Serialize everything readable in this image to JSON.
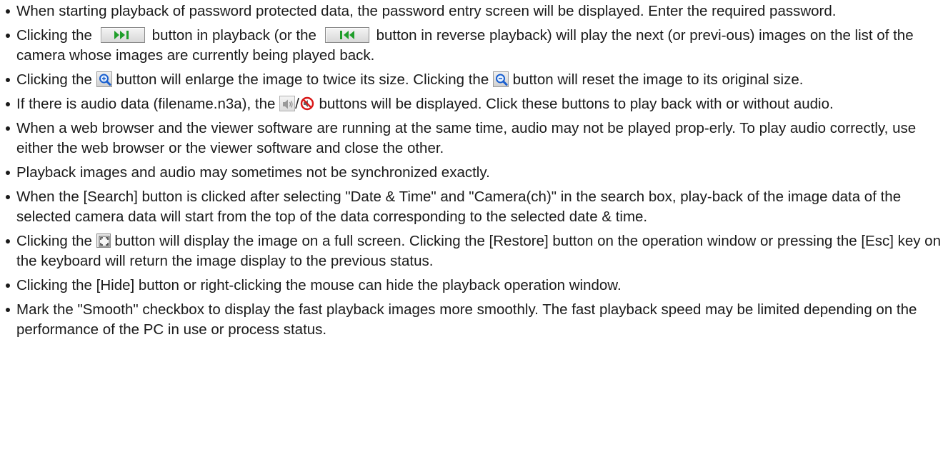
{
  "bullets": [
    {
      "text": "When starting playback of password protected data, the password entry screen will be displayed. Enter the required password."
    },
    {
      "p1": "Clicking the",
      "p2": "button in playback (or the",
      "p3": "button in reverse playback) will play the next (or previ-ous) images on the list of the camera whose images are currently being played back.",
      "icons": [
        "next-track-icon",
        "previous-track-icon"
      ]
    },
    {
      "p1": "Clicking the",
      "p2": "button will enlarge the image to twice its size. Clicking the",
      "p3": "button will reset the image to its original size.",
      "icons": [
        "zoom-in-icon",
        "zoom-reset-icon"
      ]
    },
    {
      "p1": "If there is audio data (filename.n3a), the",
      "sep": "/",
      "p2": "buttons will be displayed. Click these buttons to play back with or without audio.",
      "icons": [
        "speaker-icon",
        "mute-icon"
      ]
    },
    {
      "text": "When a web browser and the viewer software are running at the same time, audio may not be played prop-erly. To play audio correctly, use either the web browser or the viewer software and close the other."
    },
    {
      "text": "Playback images and audio may sometimes not be synchronized exactly."
    },
    {
      "text": "When the [Search] button is clicked after selecting \"Date & Time\" and \"Camera(ch)\" in the search box, play-back of the image data of the selected camera data will start from the top of the data corresponding to the selected date & time."
    },
    {
      "p1": "Clicking the",
      "p2": "button will display the image on a full screen. Clicking the [Restore] button on the operation window or pressing the [Esc] key on the keyboard will return the image display to the previous status.",
      "icons": [
        "fullscreen-icon"
      ]
    },
    {
      "text": "Clicking the [Hide] button or right-clicking the mouse can hide the playback operation window."
    },
    {
      "text": "Mark the \"Smooth\" checkbox to display the fast playback images more smoothly. The fast playback speed may be limited depending on the performance of the PC in use or process status."
    }
  ],
  "colors": {
    "text": "#1a1a1a",
    "transport_icon": "#1f9e2a",
    "zoom_icon": "#1a5fcf",
    "mute_icon": "#d81818"
  }
}
